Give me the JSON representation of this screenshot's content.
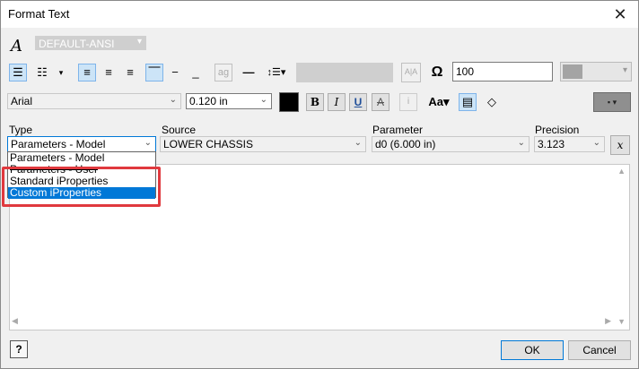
{
  "window": {
    "title": "Format Text",
    "close_icon": "close-icon"
  },
  "style": {
    "value": "DEFAULT-ANSI"
  },
  "spacing": {
    "value": "100"
  },
  "font": {
    "family": "Arial",
    "size": "0.120 in",
    "color": "#000000"
  },
  "format_buttons": {
    "bold": "B",
    "italic": "I",
    "underline": "U",
    "strike": "A"
  },
  "labels": {
    "type": "Type",
    "source": "Source",
    "parameter": "Parameter",
    "precision": "Precision"
  },
  "type": {
    "selected": "Parameters - Model",
    "options": [
      "Parameters - Model",
      "Parameters - User",
      "Standard iProperties",
      "Custom iProperties"
    ],
    "highlighted_index": 3
  },
  "source": {
    "selected": "LOWER CHASSIS"
  },
  "parameter": {
    "selected": "d0 (6.000 in)"
  },
  "precision": {
    "selected": "3.123"
  },
  "footer": {
    "ok": "OK",
    "cancel": "Cancel"
  },
  "colors": {
    "accent": "#0078d7",
    "highlight_box": "#e0393e"
  }
}
